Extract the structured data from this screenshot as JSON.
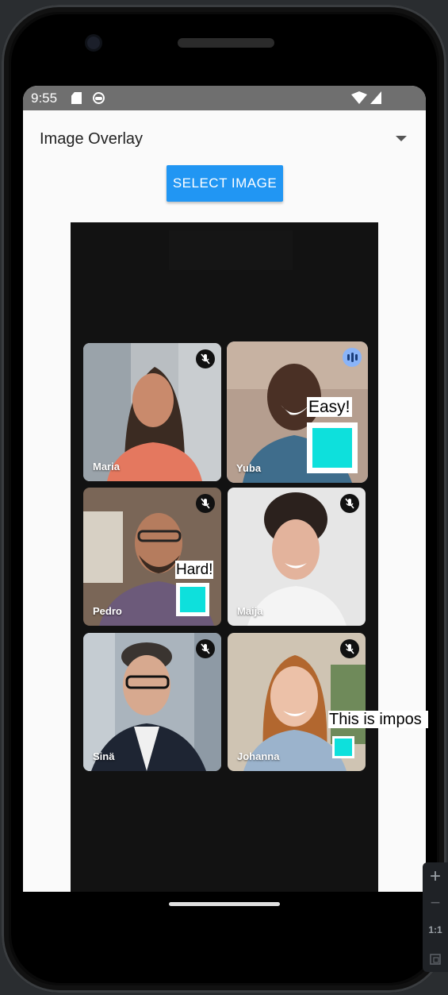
{
  "status_bar": {
    "time": "9:55"
  },
  "dropdown": {
    "selected": "Image Overlay"
  },
  "select_image_button": "SELECT IMAGE",
  "participants": [
    {
      "name": "Maria",
      "muted": true
    },
    {
      "name": "Yuba",
      "muted": false,
      "speaking": true,
      "overlay_text": "Easy!"
    },
    {
      "name": "Pedro",
      "muted": true,
      "overlay_text": "Hard!"
    },
    {
      "name": "Maija",
      "muted": true
    },
    {
      "name": "Sinä",
      "muted": true
    },
    {
      "name": "Johanna",
      "muted": true,
      "overlay_text": "This is impos"
    }
  ],
  "zoom_controls": {
    "zoom_in": "+",
    "zoom_out": "−",
    "actual_size": "1:1"
  },
  "colors": {
    "accent": "#2196f3",
    "status_bar": "#6f6f6f",
    "canvas": "#121212",
    "qr": "#0ee0dc"
  }
}
